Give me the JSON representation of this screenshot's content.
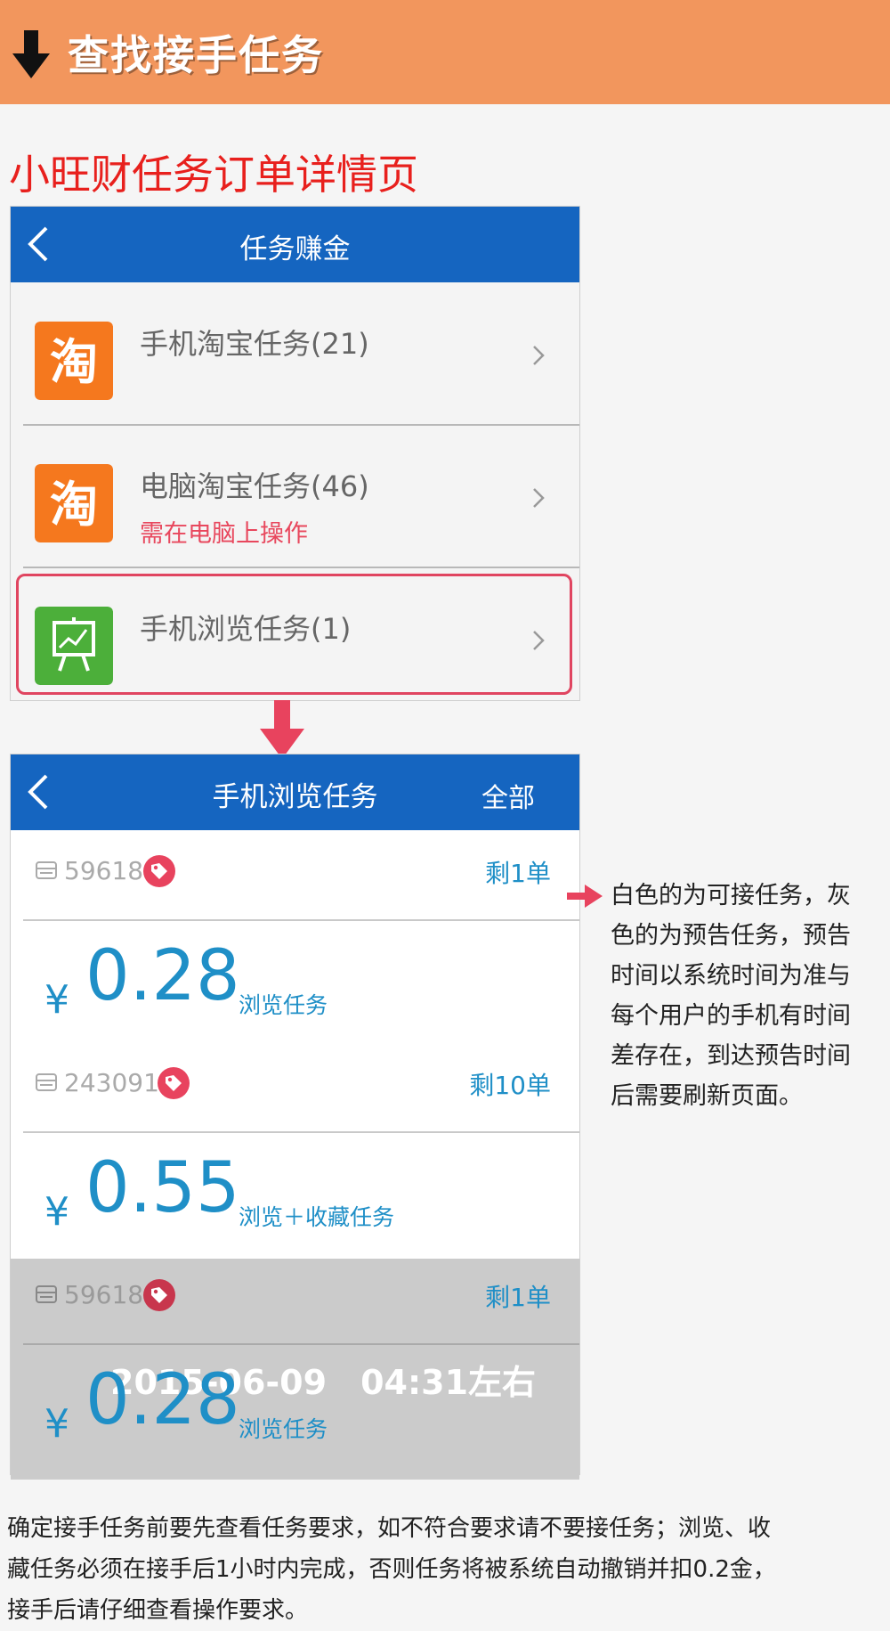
{
  "header": {
    "title": "查找接手任务"
  },
  "section_title": "小旺财任务订单详情页",
  "screen1": {
    "nav_title": "任务赚金",
    "rows": [
      {
        "label": "手机淘宝任务(21)",
        "sub": "",
        "icon": "taobao-icon"
      },
      {
        "label": "电脑淘宝任务(46)",
        "sub": "需在电脑上操作",
        "icon": "taobao-icon"
      },
      {
        "label": "手机浏览任务(1)",
        "sub": "",
        "icon": "chart-board-icon"
      }
    ]
  },
  "screen2": {
    "nav_title": "手机浏览任务",
    "nav_right": "全部",
    "cards": [
      {
        "order_id": "59618",
        "remain": "剩1单",
        "yen": "¥",
        "price": "0.28",
        "type": "浏览任务",
        "time": ""
      },
      {
        "order_id": "243091",
        "remain": "剩10单",
        "yen": "¥",
        "price": "0.55",
        "type": "浏览＋收藏任务",
        "time": ""
      },
      {
        "order_id": "59618",
        "remain": "剩1单",
        "yen": "¥",
        "price": "0.28",
        "type": "浏览任务",
        "time": "2015-06-09　04:31左右"
      }
    ]
  },
  "note_lines": [
    "白色的为可接任务，灰",
    "色的为预告任务，预告",
    "时间以系统时间为准与",
    "每个用户的手机有时间",
    "差存在，到达预告时间",
    "后需要刷新页面。"
  ],
  "footer_lines": [
    "确定接手任务前要先查看任务要求，如不符合要求请不要接任务；浏览、收",
    "藏任务必须在接手后1小时内完成，否则任务将被系统自动撤销并扣0.2金，",
    "接手后请仔细查看操作要求。"
  ],
  "colors": {
    "header_bg": "#f2965d",
    "nav_bg": "#1565c0",
    "accent_red": "#e8201d",
    "price_blue": "#1f8fc7",
    "highlight": "#e04560"
  }
}
